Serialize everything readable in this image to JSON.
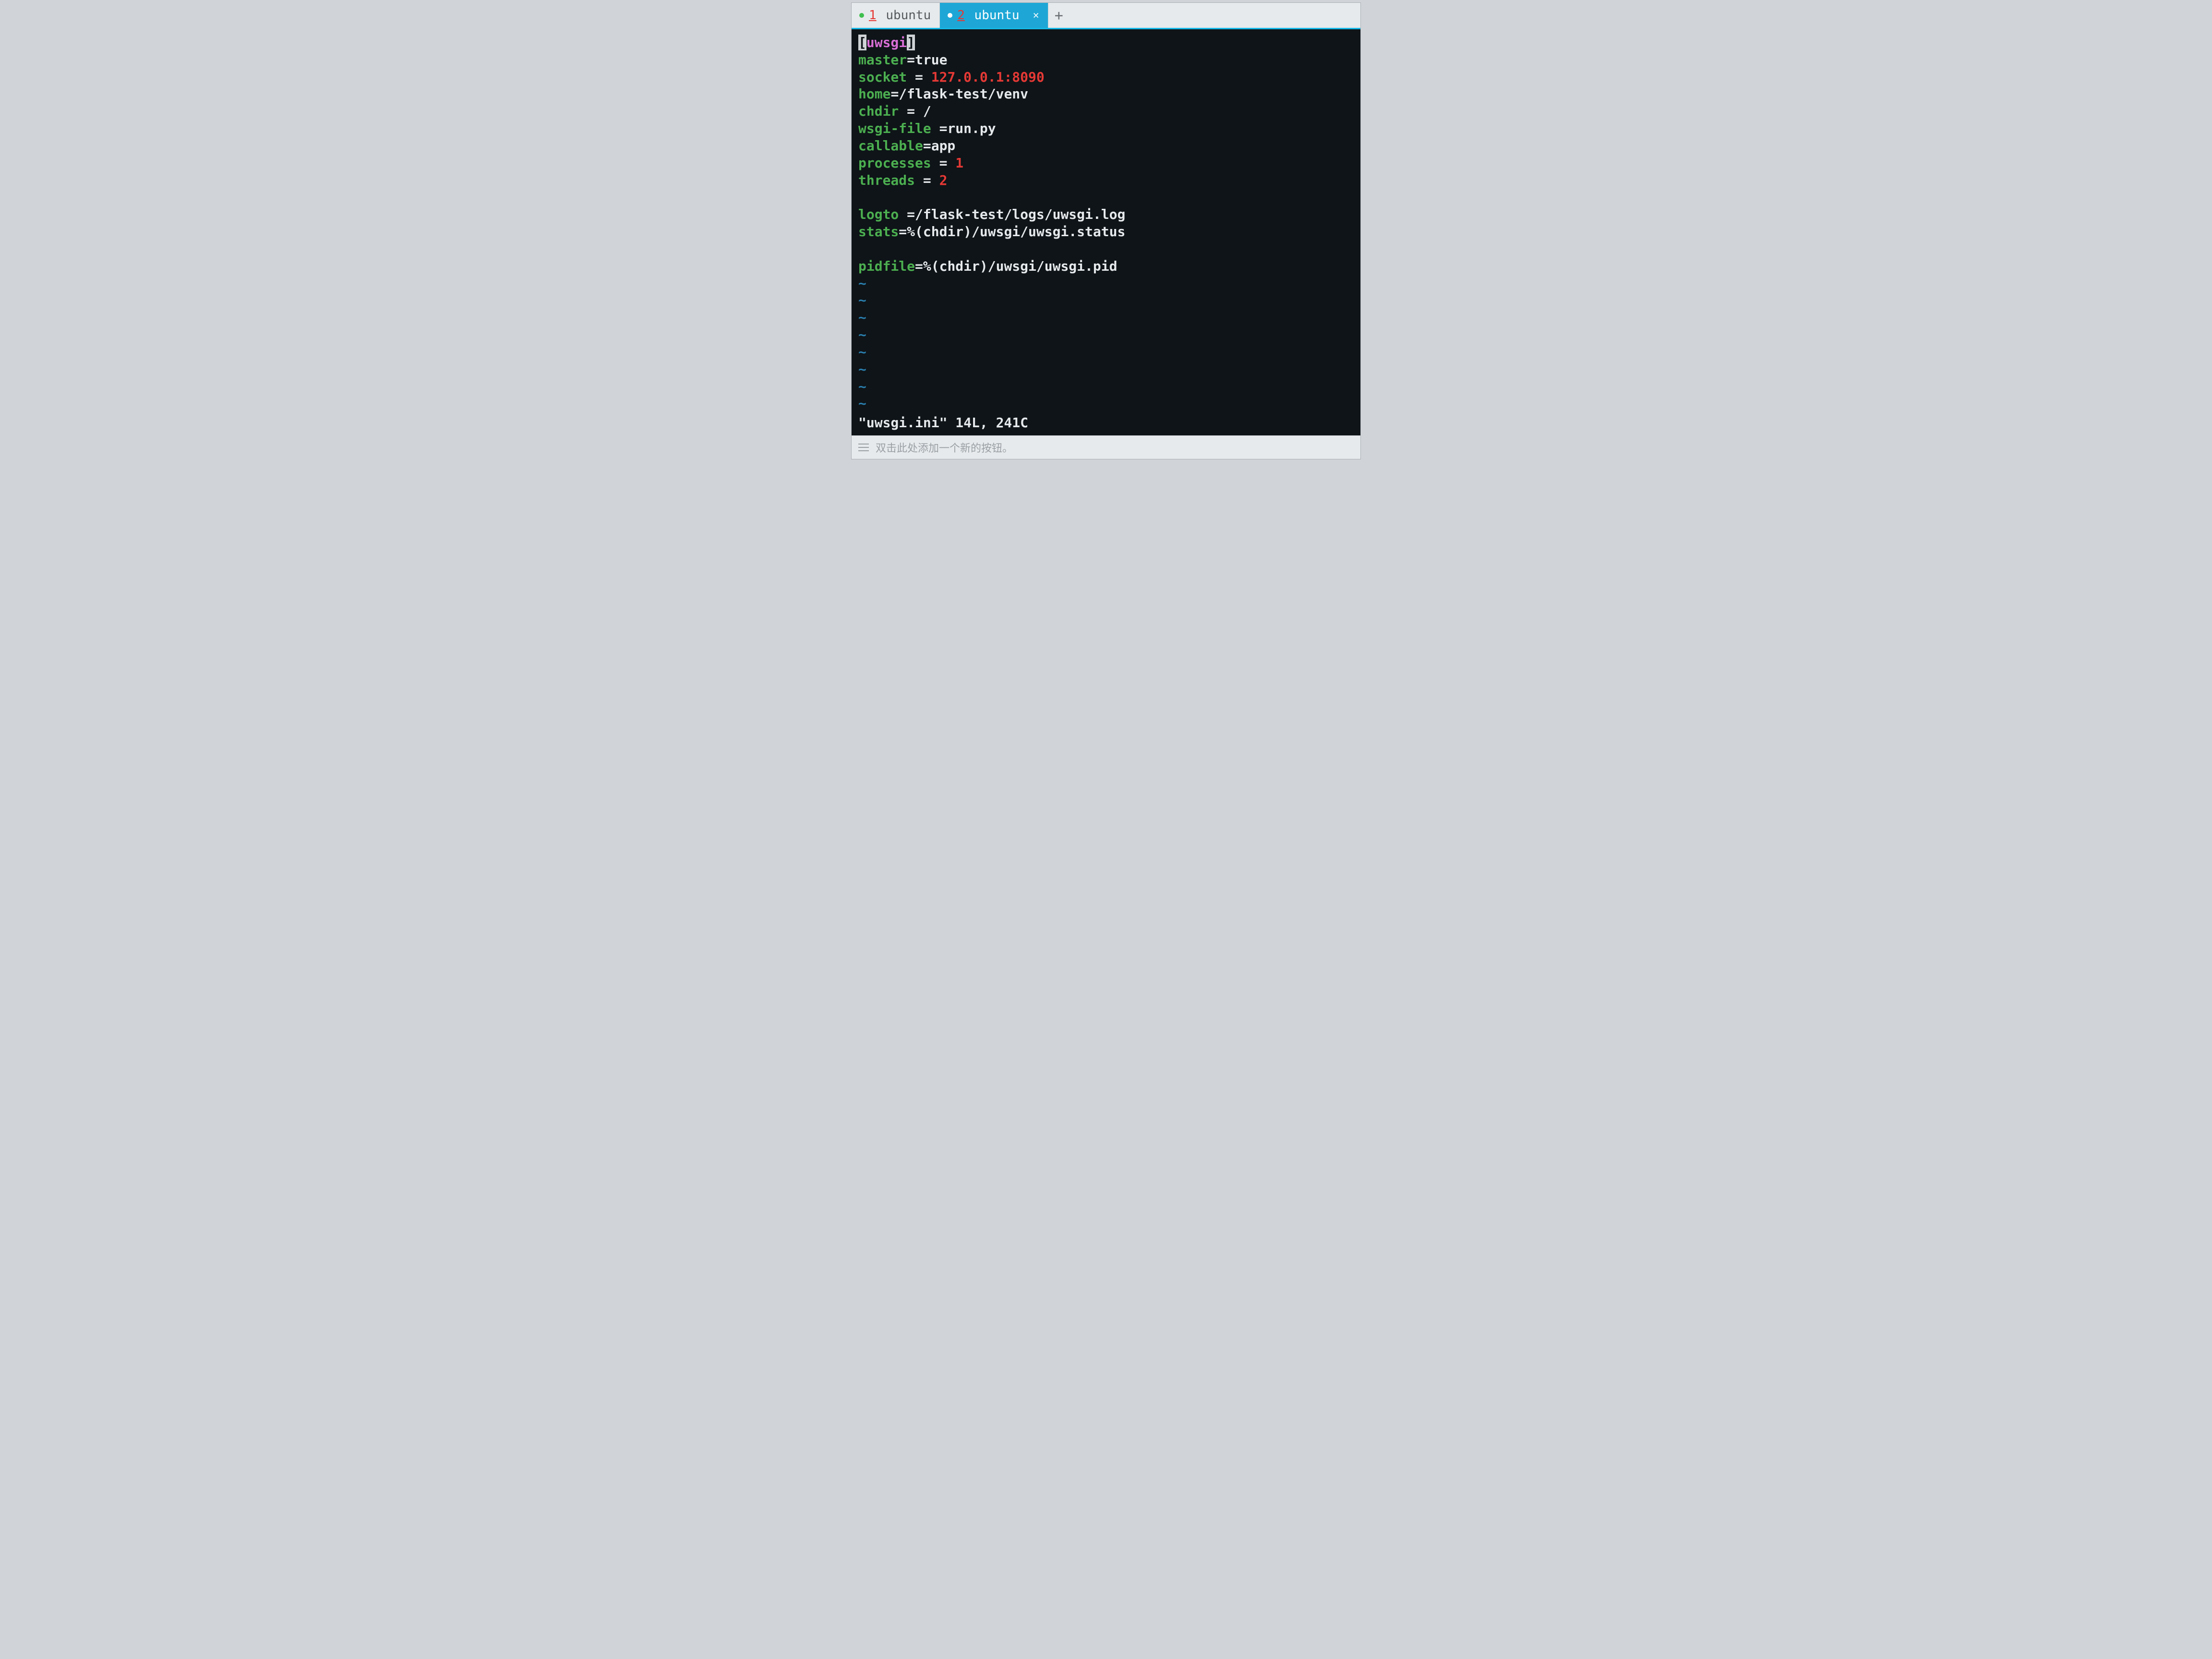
{
  "tabs": [
    {
      "index": "1",
      "label": "ubuntu",
      "active": false
    },
    {
      "index": "2",
      "label": "ubuntu",
      "active": true
    }
  ],
  "editor": {
    "section_open": "[",
    "section_name": "uwsgi",
    "section_close": "]",
    "lines": [
      {
        "key": "master",
        "eq": "=",
        "val": "true",
        "num": ""
      },
      {
        "key": "socket",
        "eq": " = ",
        "val": "",
        "num": "127.0.0.1:8090"
      },
      {
        "key": "home",
        "eq": "=",
        "val": "/flask-test/venv",
        "num": ""
      },
      {
        "key": "chdir",
        "eq": " = ",
        "val": "/",
        "num": ""
      },
      {
        "key": "wsgi-file",
        "eq": " =",
        "val": "run.py",
        "num": ""
      },
      {
        "key": "callable",
        "eq": "=",
        "val": "app",
        "num": ""
      },
      {
        "key": "processes",
        "eq": " = ",
        "val": "",
        "num": "1"
      },
      {
        "key": "threads",
        "eq": " = ",
        "val": "",
        "num": "2"
      },
      {
        "key": "",
        "eq": "",
        "val": "",
        "num": ""
      },
      {
        "key": "logto",
        "eq": " =",
        "val": "/flask-test/logs/uwsgi.log",
        "num": ""
      },
      {
        "key": "stats",
        "eq": "=",
        "val": "%(chdir)/uwsgi/uwsgi.status",
        "num": ""
      },
      {
        "key": "",
        "eq": "",
        "val": "",
        "num": ""
      },
      {
        "key": "pidfile",
        "eq": "=",
        "val": "%(chdir)/uwsgi/uwsgi.pid",
        "num": ""
      }
    ],
    "tilde_count": 8,
    "tilde": "~",
    "statusline": "\"uwsgi.ini\" 14L, 241C"
  },
  "bottombar": {
    "hint": "双击此处添加一个新的按钮。"
  }
}
